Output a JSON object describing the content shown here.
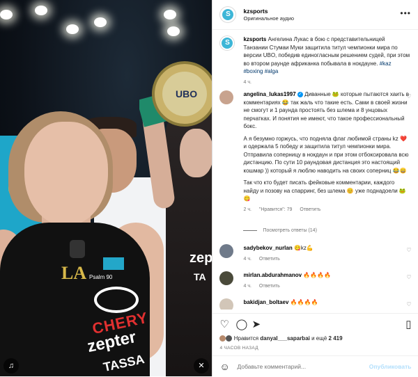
{
  "header": {
    "username": "kzsports",
    "subtitle": "Оригинальное аудио"
  },
  "caption": {
    "username": "kzsports",
    "text": "Ангелина Лукас в бою с представительницей Танзании Стумаи Муки защитила титул чемпионки мира по версии UBO, победив единогласным решением судей, при этом во втором раунде африканка побывала в нокдауне.",
    "hashtags": "#kaz #boxing #alga",
    "time": "4 ч."
  },
  "comments": [
    {
      "username": "angelina_lukas1997",
      "text": "Диванные 🐸 которые пытаются хаить в комментариях 😂 так жаль что такие есть. Сами в своей жизни не смогут и 1 раунда простоять без шлема и 8 унцовых перчатках. И понятия не имеют, что такое профессиональный бокс.",
      "text2": "А я безумно горжусь, что подняла флаг любимой страны kz ❤️ и одержала 5 победу и защитила титул чемпионки мира. Отправила соперницу в нокдаун и при этом отбоксировала всю дистанцию. По сути 10 раундовая дистанция это настоящий кошмар )) который я люблю наводить на своих соперниц 😂😄",
      "text3": "Так что кто будет писать фейковые комментарии, каждого найду и позову на спарринг, без шлема 😊 уже поднадоели 🐸😋",
      "time": "2 ч.",
      "likes": "\"Нравится\": 79",
      "reply": "Ответить",
      "view_replies": "Посмотреть ответы (14)"
    },
    {
      "username": "sadybekov_nurlan",
      "text": "😋kz💪",
      "time": "4 ч.",
      "reply": "Ответить"
    },
    {
      "username": "mirlan.abdurahmanov",
      "text": "🔥🔥🔥🔥",
      "time": "4 ч.",
      "reply": "Ответить"
    },
    {
      "username": "bakidjan_boltaev",
      "text": "🔥🔥🔥🔥",
      "time": "",
      "reply": ""
    }
  ],
  "likes": {
    "prefix": "Нравится",
    "user": "danyal___saparbai",
    "suffix": "и ещё",
    "count": "2 419"
  },
  "posted": "4 ЧАСОВ НАЗАД",
  "add_comment": {
    "placeholder": "Добавьте комментарий...",
    "publish": "Опубликовать"
  },
  "video": {
    "belt_text": "UBO",
    "jersey_brand": "CHERY",
    "jersey_sponsor": "zepter",
    "jersey_sponsor2": "TASSA",
    "jersey_initials": "LA",
    "jersey_psalm": "Psalm 90",
    "right_sponsor": "zep",
    "right_sponsor2": "TA"
  },
  "colors": {
    "accent": "#0095f6",
    "link": "#00376b",
    "logo": "#3db6d7",
    "brand_red": "#e13030"
  }
}
